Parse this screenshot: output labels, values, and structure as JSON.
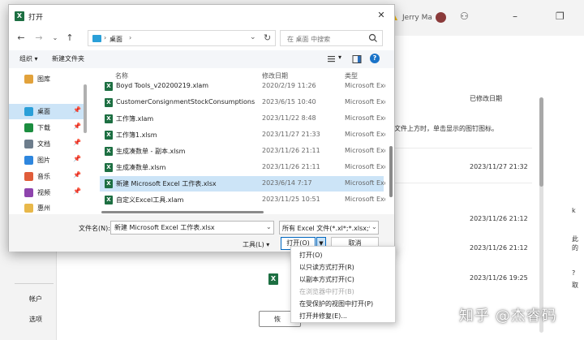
{
  "background": {
    "user_name": "Jerry Ma",
    "left_links": [
      "帐户",
      "选项"
    ],
    "header_date": "已修改日期",
    "hint": "下文件上方时，单击显示的图钉图标。",
    "dates": [
      "2023/11/27 21:32",
      "2023/11/26 21:12",
      "2023/11/26 21:12",
      "2023/11/26 19:25"
    ],
    "restore_label": "恢",
    "right_edge_labels": [
      "k",
      "此",
      "的",
      "?",
      "取"
    ],
    "watermark": "知乎 @杰睿码"
  },
  "dialog": {
    "title": "打开",
    "address": {
      "folder": "桌面",
      "sep": "›"
    },
    "search_placeholder": "在 桌面 中搜索",
    "toolbar": {
      "organize": "组织 ▾",
      "new_folder": "新建文件夹"
    },
    "nav_items": [
      {
        "label": "图库",
        "color": "#e2a23b",
        "pinned": false
      },
      {
        "label": "桌面",
        "color": "#2a9fd8",
        "pinned": true
      },
      {
        "label": "下载",
        "color": "#1b8d3f",
        "pinned": true
      },
      {
        "label": "文档",
        "color": "#6d7d8c",
        "pinned": true
      },
      {
        "label": "图片",
        "color": "#2e86de",
        "pinned": true
      },
      {
        "label": "音乐",
        "color": "#e05d3a",
        "pinned": true
      },
      {
        "label": "视频",
        "color": "#8e44ad",
        "pinned": true
      },
      {
        "label": "惠州",
        "color": "#e8b84a",
        "pinned": false
      }
    ],
    "nav_pin_glyph": "📌",
    "columns": {
      "name": "名称",
      "date": "修改日期",
      "type": "类型"
    },
    "files": [
      {
        "name": "Boyd Tools_v20200219.xlam",
        "date": "2020/2/19 11:26",
        "type": "Microsoft Excel"
      },
      {
        "name": "CustomerConsignmentStockConsumptions...",
        "date": "2023/6/15 10:40",
        "type": "Microsoft Excel"
      },
      {
        "name": "工作簿.xlam",
        "date": "2023/11/22 8:48",
        "type": "Microsoft Excel"
      },
      {
        "name": "工作簿1.xlsm",
        "date": "2023/11/27 21:33",
        "type": "Microsoft Excel"
      },
      {
        "name": "生成凑数单 - 副本.xlsm",
        "date": "2023/11/26 21:11",
        "type": "Microsoft Excel"
      },
      {
        "name": "生成凑数单.xlsm",
        "date": "2023/11/26 21:11",
        "type": "Microsoft Excel"
      },
      {
        "name": "新建 Microsoft Excel 工作表.xlsx",
        "date": "2023/6/14 7:17",
        "type": "Microsoft Excel"
      },
      {
        "name": "自定义Excel工具.xlam",
        "date": "2023/11/25 10:51",
        "type": "Microsoft Excel"
      }
    ],
    "selected_file_index": 6,
    "filename_label": "文件名(N):",
    "filename_value": "新建 Microsoft Excel 工作表.xlsx",
    "filter": "所有 Excel 文件(*.xl*;*.xlsx;*.xls",
    "tools_label": "工具(L) ▾",
    "open_label": "打开(O)",
    "open_split_glyph": "▼",
    "cancel_label": "取消",
    "excel_glyph": "X"
  },
  "open_menu": {
    "items": [
      {
        "label": "打开(O)",
        "enabled": true
      },
      {
        "label": "以只读方式打开(R)",
        "enabled": true
      },
      {
        "label": "以副本方式打开(C)",
        "enabled": true
      },
      {
        "label": "在浏览器中打开(B)",
        "enabled": false
      },
      {
        "label": "在受保护的视图中打开(P)",
        "enabled": true
      },
      {
        "label": "打开并修复(E)...",
        "enabled": true
      }
    ]
  },
  "colors": {
    "excel_green": "#1d6f42",
    "selection": "#cce4f7",
    "accent": "#0067c0"
  }
}
